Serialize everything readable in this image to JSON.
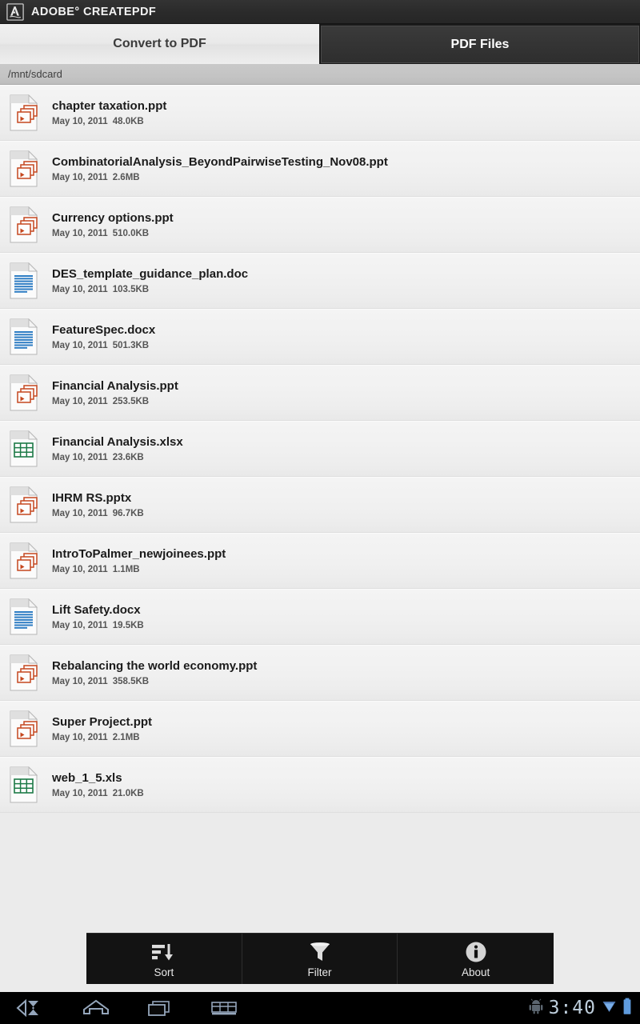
{
  "titlebar": {
    "logo_icon": "adobe-a-logo-icon",
    "title": "ADOBE° CREATEPDF"
  },
  "tabs": [
    {
      "label": "Convert to PDF",
      "state": "inactive"
    },
    {
      "label": "PDF Files",
      "state": "active"
    }
  ],
  "pathbar": {
    "path": "/mnt/sdcard"
  },
  "files": [
    {
      "name": "chapter taxation.ppt",
      "date": "May 10, 2011",
      "size": "48.0KB",
      "type": "ppt"
    },
    {
      "name": "CombinatorialAnalysis_BeyondPairwiseTesting_Nov08.ppt",
      "date": "May 10, 2011",
      "size": "2.6MB",
      "type": "ppt"
    },
    {
      "name": "Currency options.ppt",
      "date": "May 10, 2011",
      "size": "510.0KB",
      "type": "ppt"
    },
    {
      "name": "DES_template_guidance_plan.doc",
      "date": "May 10, 2011",
      "size": "103.5KB",
      "type": "doc"
    },
    {
      "name": "FeatureSpec.docx",
      "date": "May 10, 2011",
      "size": "501.3KB",
      "type": "doc"
    },
    {
      "name": "Financial Analysis.ppt",
      "date": "May 10, 2011",
      "size": "253.5KB",
      "type": "ppt"
    },
    {
      "name": "Financial Analysis.xlsx",
      "date": "May 10, 2011",
      "size": "23.6KB",
      "type": "xls"
    },
    {
      "name": "IHRM RS.pptx",
      "date": "May 10, 2011",
      "size": "96.7KB",
      "type": "ppt"
    },
    {
      "name": "IntroToPalmer_newjoinees.ppt",
      "date": "May 10, 2011",
      "size": "1.1MB",
      "type": "ppt"
    },
    {
      "name": "Lift Safety.docx",
      "date": "May 10, 2011",
      "size": "19.5KB",
      "type": "doc"
    },
    {
      "name": "Rebalancing the world economy.ppt",
      "date": "May 10, 2011",
      "size": "358.5KB",
      "type": "ppt"
    },
    {
      "name": "Super Project.ppt",
      "date": "May 10, 2011",
      "size": "2.1MB",
      "type": "ppt"
    },
    {
      "name": "web_1_5.xls",
      "date": "May 10, 2011",
      "size": "21.0KB",
      "type": "xls"
    }
  ],
  "actionbar": [
    {
      "label": "Sort",
      "icon": "sort-descending-icon"
    },
    {
      "label": "Filter",
      "icon": "funnel-icon"
    },
    {
      "label": "About",
      "icon": "info-circle-icon"
    }
  ],
  "navbar": {
    "buttons": [
      {
        "icon": "back-icon"
      },
      {
        "icon": "home-icon"
      },
      {
        "icon": "recent-apps-icon"
      },
      {
        "icon": "keyboard-icon"
      }
    ],
    "status": {
      "android_icon": "android-robot-icon",
      "clock": "3:40",
      "wifi_icon": "wifi-icon",
      "battery_icon": "battery-icon"
    }
  },
  "colors": {
    "ppt_accent": "#c5471f",
    "doc_accent": "#2f7ec4",
    "xls_accent": "#1d7a47",
    "titlebar_bg": "#2b2b2b",
    "active_tab_bg": "#343434",
    "row_bg": "#f1f1f1",
    "page_bg": "#ebebeb",
    "clock_color": "#cfe0ef"
  }
}
